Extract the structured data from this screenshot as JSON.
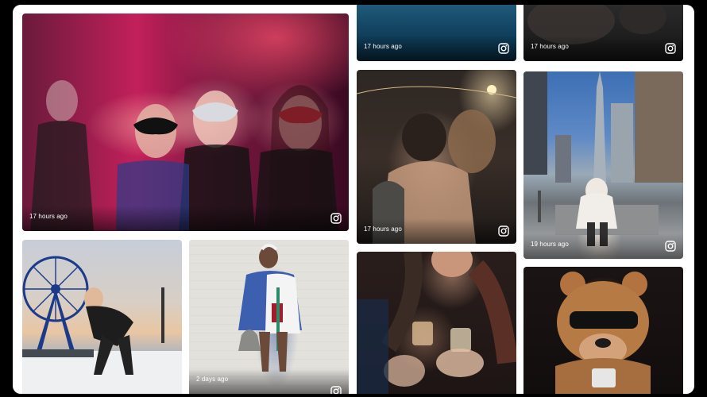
{
  "feed": {
    "tiles": [
      {
        "id": "party",
        "time": "17 hours ago",
        "icon": "instagram-icon"
      },
      {
        "id": "top-blue",
        "time": "17 hours ago",
        "icon": "instagram-icon"
      },
      {
        "id": "top-dark",
        "time": "17 hours ago",
        "icon": "instagram-icon"
      },
      {
        "id": "kiss",
        "time": "17 hours ago",
        "icon": "instagram-icon"
      },
      {
        "id": "city",
        "time": "19 hours ago",
        "icon": "instagram-icon"
      },
      {
        "id": "ferris-wheel",
        "time": "",
        "icon": ""
      },
      {
        "id": "wall",
        "time": "2 days ago",
        "icon": "instagram-icon"
      },
      {
        "id": "drinks",
        "time": "",
        "icon": ""
      },
      {
        "id": "bear",
        "time": "",
        "icon": ""
      }
    ]
  },
  "colors": {
    "frame": "#ffffff",
    "background": "#000000",
    "timestamp": "#ffffff"
  }
}
